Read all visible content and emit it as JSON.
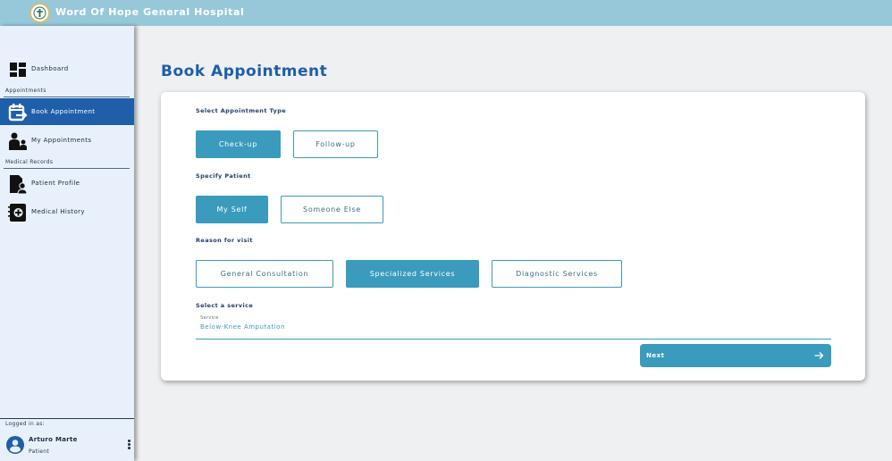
{
  "app": {
    "title": "Word Of Hope General Hospital",
    "logo_icon": "hospital-cross-emblem-icon"
  },
  "sidebar": {
    "items": [
      {
        "label": "Dashboard",
        "icon": "dashboard-grid-icon",
        "active": false
      },
      {
        "label": "Book Appointment",
        "icon": "calendar-arrow-icon",
        "active": true
      },
      {
        "label": "My Appointments",
        "icon": "doctor-patient-icon",
        "active": false
      },
      {
        "label": "Patient Profile",
        "icon": "user-document-icon",
        "active": false
      },
      {
        "label": "Medical History",
        "icon": "medical-notebook-icon",
        "active": false
      }
    ],
    "sections": {
      "appointments": "Appointments",
      "medical_records": "Medical Records"
    },
    "user": {
      "logged_in_label": "Logged in as:",
      "name": "Arturo Marte",
      "role": "Patient",
      "avatar_icon": "user-avatar-icon",
      "menu_icon": "more-vertical-icon"
    }
  },
  "main": {
    "page_title": "Book Appointment",
    "appointment_type": {
      "label": "Select Appointment Type",
      "options": [
        "Check-up",
        "Follow-up"
      ],
      "selected": "Check-up"
    },
    "patient": {
      "label": "Specify Patient",
      "options": [
        "My Self",
        "Someone Else"
      ],
      "selected": "My Self"
    },
    "reason": {
      "label": "Reason for visit",
      "options": [
        "General Consultation",
        "Specialized Services",
        "Diagnostic Services"
      ],
      "selected": "Specialized Services"
    },
    "service": {
      "label": "Select a service",
      "field_label": "Service",
      "value": "Below-Knee Amputation"
    },
    "next_label": "Next",
    "next_icon": "arrow-right-icon"
  },
  "colors": {
    "topbar": "#96c8d9",
    "sidebar_bg": "#e8f1fb",
    "active_nav": "#1f5ea8",
    "accent": "#3a9bbd",
    "title": "#1f5ea8"
  }
}
